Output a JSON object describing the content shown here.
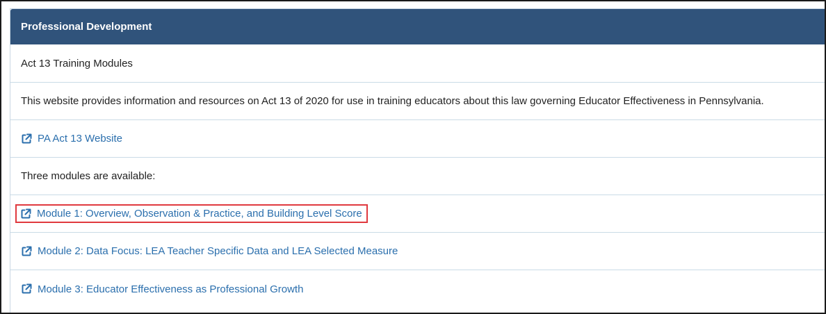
{
  "panel": {
    "title": "Professional Development"
  },
  "rows": {
    "heading": "Act 13 Training Modules",
    "description": "This website provides information and resources on Act 13 of 2020 for use in training educators about this law governing Educator Effectiveness in Pennsylvania.",
    "website_link": "PA Act 13 Website",
    "modules_intro": "Three modules are available:",
    "module_1": "Module 1: Overview, Observation & Practice, and Building Level Score",
    "module_2": "Module 2: Data Focus: LEA Teacher Specific Data and LEA Selected Measure",
    "module_3": "Module 3: Educator Effectiveness as Professional Growth"
  },
  "icons": {
    "external_link": "external-link-icon"
  },
  "colors": {
    "header_bg": "#30537b",
    "link": "#2b6fad",
    "highlight_border": "#e0393e",
    "row_divider": "#c9dbe6"
  }
}
